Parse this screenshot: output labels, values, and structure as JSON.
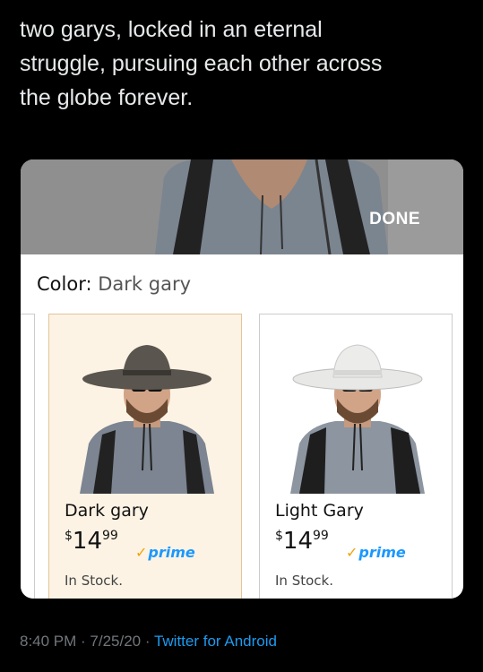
{
  "tweet": {
    "text_line1": "two garys, locked in an eternal",
    "text_line2": "struggle, pursuing each other across",
    "text_line3": "the globe forever."
  },
  "popup": {
    "done_label": "DONE",
    "color_label": "Color:",
    "color_value": "Dark gary",
    "options": [
      {
        "name": "Dark gary",
        "currency": "$",
        "price_whole": "14",
        "price_fraction": "99",
        "prime_label": "prime",
        "stock": "In Stock.",
        "selected": true,
        "hat_color": "#5a554e"
      },
      {
        "name": "Light Gary",
        "currency": "$",
        "price_whole": "14",
        "price_fraction": "99",
        "prime_label": "prime",
        "stock": "In Stock.",
        "selected": false,
        "hat_color": "#e8e8e6"
      }
    ]
  },
  "footer": {
    "time": "8:40 PM · 7/25/20 ·",
    "source": "Twitter for Android"
  },
  "colors": {
    "prime_blue": "#1a98ff",
    "selected_bg": "#fcf3e4",
    "link_blue": "#1d9bf0"
  },
  "icons": [
    "prime-check-icon",
    "product-photo"
  ]
}
